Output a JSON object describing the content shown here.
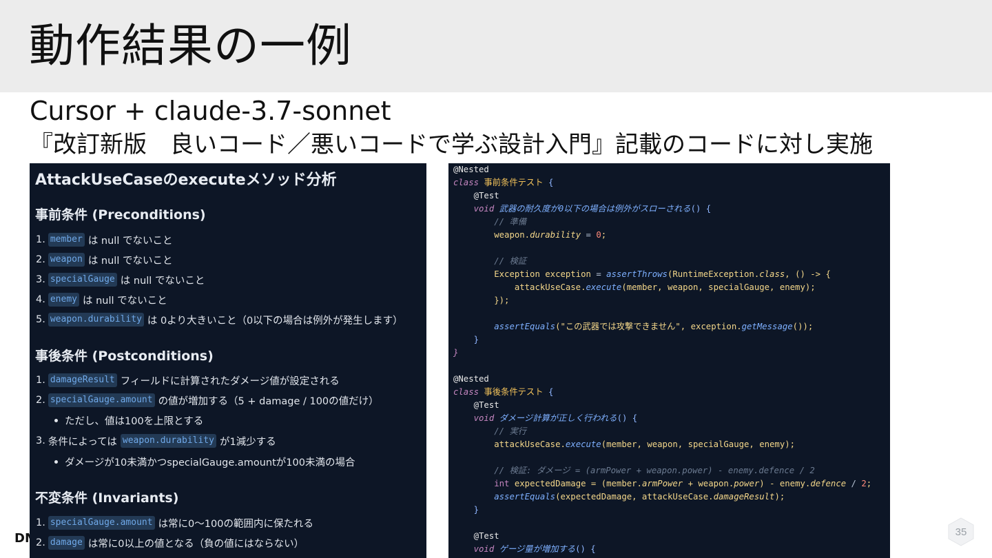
{
  "title": "動作結果の一例",
  "subtitle_line1": "Cursor + claude-3.7-sonnet",
  "subtitle_line2": "『改訂新版　良いコード／悪いコードで学ぶ設計入門』記載のコードに対し実施",
  "left_panel": {
    "heading": "AttackUseCaseのexecuteメソッド分析",
    "pre": {
      "title": "事前条件 (Preconditions)",
      "items": [
        {
          "num": "1.",
          "code": "member",
          "text": "は null でないこと"
        },
        {
          "num": "2.",
          "code": "weapon",
          "text": "は null でないこと"
        },
        {
          "num": "3.",
          "code": "specialGauge",
          "text": "は null でないこと"
        },
        {
          "num": "4.",
          "code": "enemy",
          "text": "は null でないこと"
        },
        {
          "num": "5.",
          "code": "weapon.durability",
          "text": "は 0より大きいこと（0以下の場合は例外が発生します）"
        }
      ]
    },
    "post": {
      "title": "事後条件 (Postconditions)",
      "item1": {
        "num": "1.",
        "code": "damageResult",
        "text": "フィールドに計算されたダメージ値が設定される"
      },
      "item2": {
        "num": "2.",
        "code": "specialGauge.amount",
        "text": "の値が増加する（5 + damage / 100の値だけ）"
      },
      "item2_sub": "ただし、値は100を上限とする",
      "item3": {
        "num": "3.",
        "prefix": "条件によっては",
        "code": "weapon.durability",
        "text": "が1減少する"
      },
      "item3_sub": "ダメージが10未満かつspecialGauge.amountが100未満の場合"
    },
    "inv": {
      "title": "不変条件 (Invariants)",
      "items": [
        {
          "num": "1.",
          "code": "specialGauge.amount",
          "text": "は常に0〜100の範囲内に保たれる"
        },
        {
          "num": "2.",
          "code": "damage",
          "text": "は常に0以上の値となる（負の値にはならない）"
        }
      ]
    }
  },
  "code": {
    "l1": "@Nested",
    "l2_kw": "class",
    "l2_name": "事前条件テスト",
    "l2_br": "{",
    "l3": "@Test",
    "l4_kw": "void",
    "l4_fn": "武器の耐久度が0以下の場合は例外がスローされる",
    "l4_br": "() {",
    "l5": "// 準備",
    "l6_var": "weapon.",
    "l6_prop": "durability",
    "l6_op": " = ",
    "l6_num": "0",
    "l6_end": ";",
    "l8": "// 検証",
    "l9_type": "Exception",
    "l9_var": " exception ",
    "l9_op": "= ",
    "l9_fn": "assertThrows",
    "l9_a": "(RuntimeException.",
    "l9_kw": "class",
    "l9_b": ", () -> {",
    "l10_var": "attackUseCase.",
    "l10_fn": "execute",
    "l10_args": "(member, weapon, specialGauge, enemy);",
    "l11": "});",
    "l13_fn": "assertEquals",
    "l13_str": "(\"この武器では攻撃できません\", exception.",
    "l13_fn2": "getMessage",
    "l13_end": "());",
    "l14": "}",
    "l15": "}",
    "l17": "@Nested",
    "l18_kw": "class",
    "l18_name": "事後条件テスト",
    "l18_br": "{",
    "l19": "@Test",
    "l20_kw": "void",
    "l20_fn": "ダメージ計算が正しく行われる",
    "l20_br": "() {",
    "l21": "// 実行",
    "l22_var": "attackUseCase.",
    "l22_fn": "execute",
    "l22_args": "(member, weapon, specialGauge, enemy);",
    "l24": "// 検証: ダメージ = (armPower + weapon.power) - enemy.defence / 2",
    "l25_type": "int",
    "l25_a": " expectedDamage = (member.",
    "l25_p1": "armPower",
    "l25_b": " + weapon.",
    "l25_p2": "power",
    "l25_c": ") - enemy.",
    "l25_p3": "defence",
    "l25_d": " / ",
    "l25_num": "2",
    "l25_end": ";",
    "l26_fn": "assertEquals",
    "l26_a": "(expectedDamage, attackUseCase.",
    "l26_p": "damageResult",
    "l26_end": ");",
    "l27": "}",
    "l29": "@Test",
    "l30_kw": "void",
    "l30_fn": "ゲージ量が増加する",
    "l30_br": "() {"
  },
  "footer": {
    "logo": "DM",
    "page_number": "35"
  }
}
